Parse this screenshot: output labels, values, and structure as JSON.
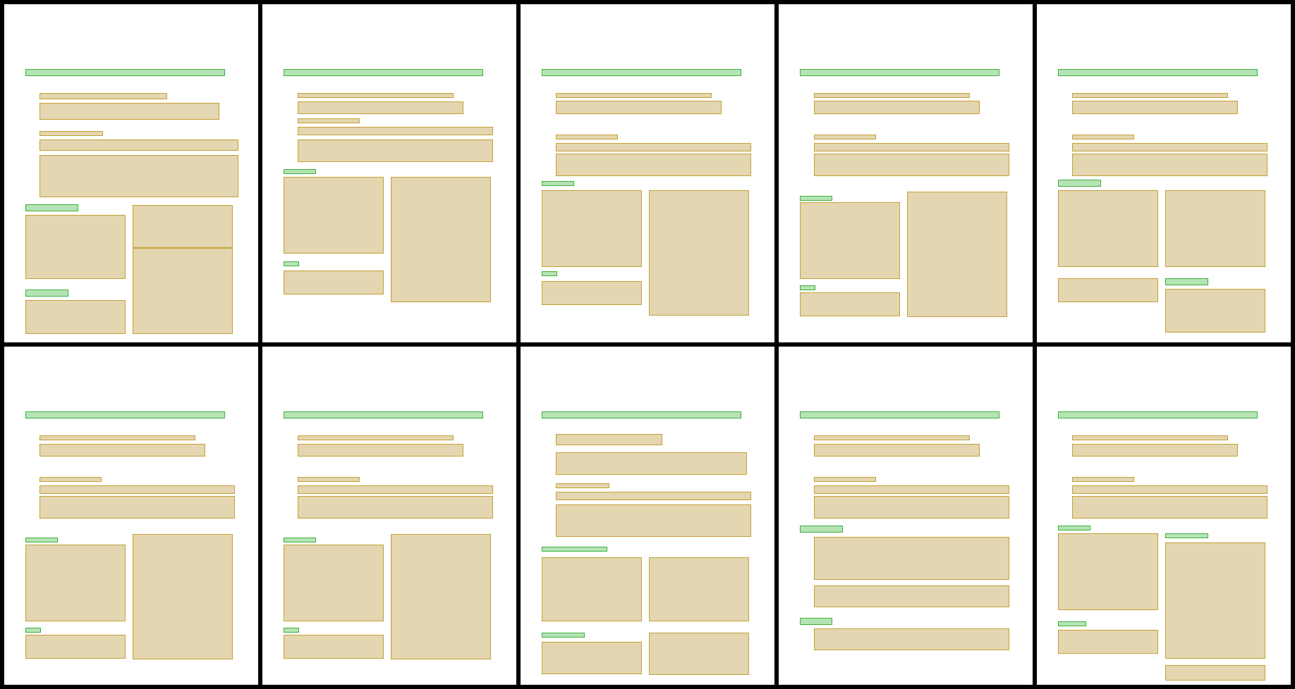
{
  "colors": {
    "background": "#000000",
    "panel": "#ffffff",
    "heading_fill": "#b5e4b4",
    "heading_stroke": "#3fae3d",
    "block_fill": "#e3d6b1",
    "block_stroke": "#c6a035"
  },
  "block_types": [
    "heading",
    "block"
  ],
  "grid": {
    "rows": 2,
    "columns": 5,
    "panel_count": 10
  }
}
